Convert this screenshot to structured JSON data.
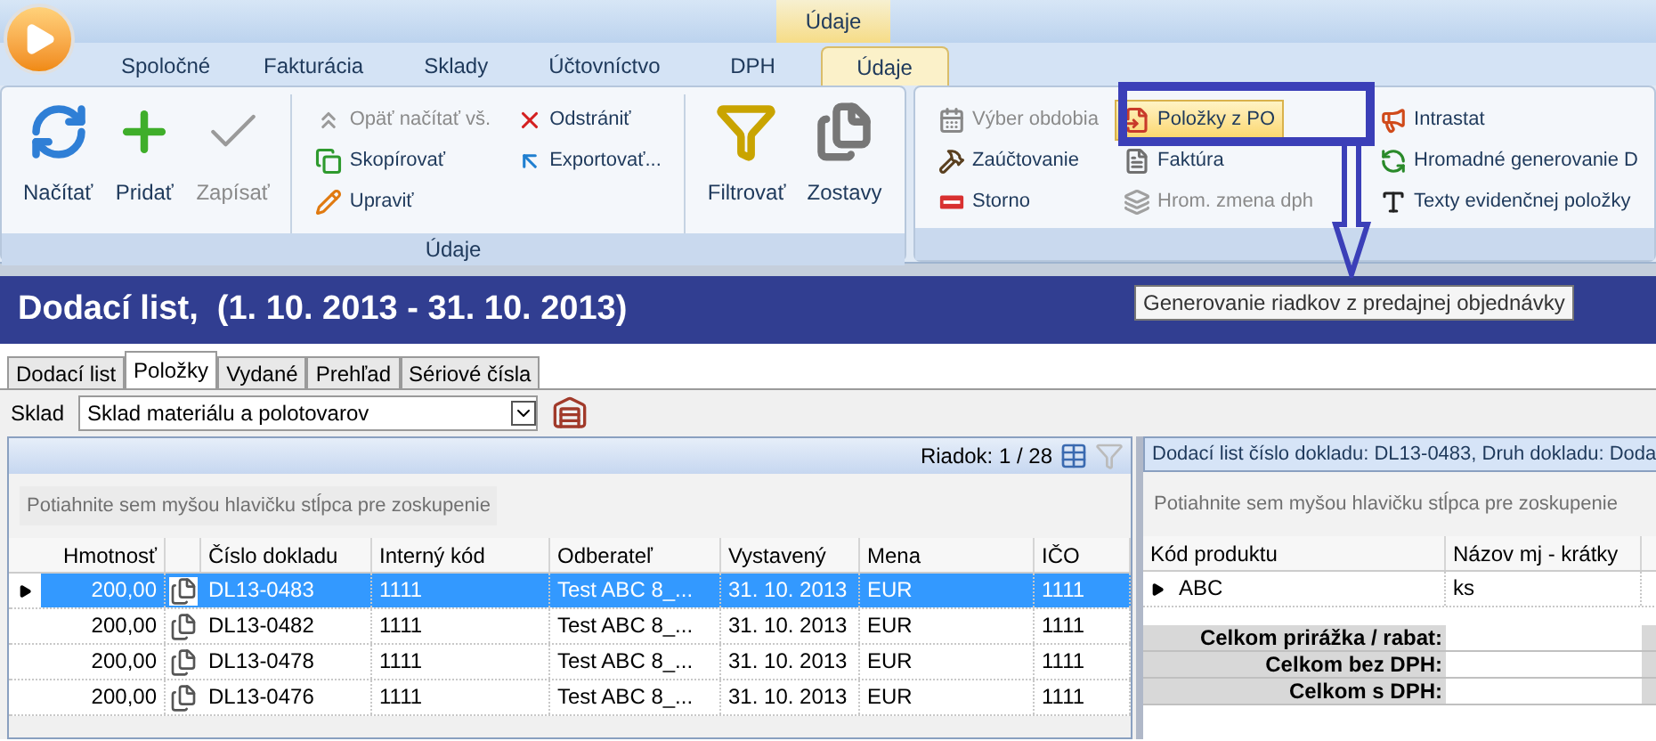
{
  "context_tab_header": "Údaje",
  "ribbon_tabs": [
    {
      "label": "Spoločné",
      "selected": false
    },
    {
      "label": "Fakturácia",
      "selected": false
    },
    {
      "label": "Sklady",
      "selected": false
    },
    {
      "label": "Účtovníctvo",
      "selected": false
    },
    {
      "label": "DPH",
      "selected": false
    },
    {
      "label": "Údaje",
      "selected": true
    }
  ],
  "ribbon_groups": [
    {
      "label": "Údaje",
      "sections": [
        {
          "kind": "large",
          "items": [
            {
              "label": "Načítať",
              "disabled": false,
              "highlighted": false
            },
            {
              "label": "Pridať",
              "disabled": false,
              "highlighted": false
            },
            {
              "label": "Zapísať",
              "disabled": true,
              "highlighted": false
            }
          ]
        },
        {
          "kind": "small",
          "items": [
            {
              "label": "Opäť načítať vš.",
              "disabled": true,
              "highlighted": false
            },
            {
              "label": "Skopírovať",
              "disabled": false,
              "highlighted": false
            },
            {
              "label": "Upraviť",
              "disabled": false,
              "highlighted": false
            }
          ]
        },
        {
          "kind": "small",
          "items": [
            {
              "label": "Odstrániť",
              "disabled": false,
              "highlighted": false
            },
            {
              "label": "Exportovať...",
              "disabled": false,
              "highlighted": false
            }
          ]
        },
        {
          "kind": "large",
          "items": [
            {
              "label": "Filtrovať",
              "disabled": false,
              "highlighted": false
            }
          ]
        },
        {
          "kind": "large",
          "items": [
            {
              "label": "Zostavy",
              "disabled": false,
              "highlighted": false
            }
          ]
        }
      ]
    },
    {
      "sections": [
        {
          "kind": "small",
          "items": [
            {
              "label": "Výber obdobia",
              "disabled": true,
              "highlighted": false
            },
            {
              "label": "Zaúčtovanie",
              "disabled": false,
              "highlighted": false
            },
            {
              "label": "Storno",
              "disabled": false,
              "highlighted": false
            }
          ]
        },
        {
          "kind": "small",
          "items": [
            {
              "label": "Položky z PO",
              "disabled": false,
              "highlighted": true
            },
            {
              "label": "Faktúra",
              "disabled": false,
              "highlighted": false
            },
            {
              "label": "Hrom. zmena dph",
              "disabled": true,
              "highlighted": false
            }
          ]
        },
        {
          "kind": "small",
          "items": [
            {
              "label": "Intrastat",
              "disabled": false,
              "highlighted": false
            },
            {
              "label": "Hromadné generovanie D",
              "disabled": false,
              "highlighted": false
            },
            {
              "label": "Texty evidenčnej položky",
              "disabled": false,
              "highlighted": false
            }
          ]
        }
      ]
    }
  ],
  "tooltip": "Generovanie riadkov z predajnej objednávky",
  "document": {
    "title": "Dodací list,  (1. 10. 2013 - 31. 10. 2013)",
    "tabs": [
      {
        "label": "Dodací list",
        "selected": false
      },
      {
        "label": "Položky",
        "selected": true
      },
      {
        "label": "Vydané",
        "selected": false
      },
      {
        "label": "Prehľad",
        "selected": false
      },
      {
        "label": "Sériové čísla",
        "selected": false
      }
    ],
    "warehouse": {
      "label": "Sklad",
      "value": "Sklad materiálu a polotovarov"
    }
  },
  "left_grid": {
    "row_counter": "Riadok: 1 / 28",
    "group_hint": "Potiahnite sem myšou hlavičku stĺpca pre zoskupenie",
    "columns": [
      "Hmotnosť",
      "Číslo dokladu",
      "Interný kód",
      "Odberateľ",
      "Vystavený",
      "Mena",
      "IČO"
    ],
    "rows": [
      {
        "current": true,
        "selected": true,
        "cells": [
          "200,00",
          "DL13-0483",
          "1111",
          "Test ABC 8_...",
          "31. 10. 2013",
          "EUR",
          "1111"
        ]
      },
      {
        "current": false,
        "selected": false,
        "cells": [
          "200,00",
          "DL13-0482",
          "1111",
          "Test ABC 8_...",
          "31. 10. 2013",
          "EUR",
          "1111"
        ]
      },
      {
        "current": false,
        "selected": false,
        "cells": [
          "200,00",
          "DL13-0478",
          "1111",
          "Test ABC 8_...",
          "31. 10. 2013",
          "EUR",
          "1111"
        ]
      },
      {
        "current": false,
        "selected": false,
        "cells": [
          "200,00",
          "DL13-0476",
          "1111",
          "Test ABC 8_...",
          "31. 10. 2013",
          "EUR",
          "1111"
        ]
      }
    ]
  },
  "right_grid": {
    "header": "Dodací list číslo dokladu: DL13-0483, Druh dokladu: Doda",
    "group_hint": "Potiahnite sem myšou hlavičku stĺpca pre zoskupenie",
    "columns": [
      "Kód produktu",
      "Názov mj - krátky"
    ],
    "rows": [
      {
        "current": true,
        "cells": [
          "ABC",
          "ks"
        ]
      }
    ],
    "totals": [
      "Celkom prirážka / rabat:",
      "Celkom bez DPH:",
      "Celkom s DPH:"
    ]
  }
}
